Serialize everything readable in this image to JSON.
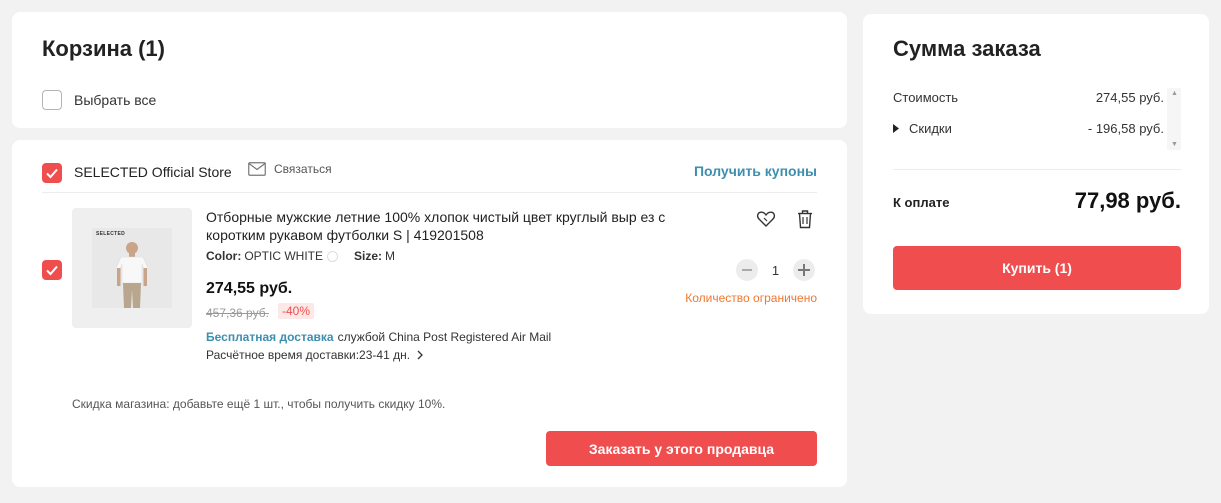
{
  "cart": {
    "title": "Корзина (1)",
    "select_all_label": "Выбрать все",
    "select_all_checked": false
  },
  "store": {
    "name": "SELECTED Official Store",
    "checked": true,
    "contact_label": "Связаться",
    "coupons_label": "Получить купоны",
    "item": {
      "checked": true,
      "thumbnail_brand": "SELECTED",
      "title": "Отборные мужские летние 100% хлопок чистый цвет круглый выр ез с коротким рукавом футболки S | 419201508",
      "color_key": "Color:",
      "color_value": "OPTIC WHITE",
      "size_key": "Size:",
      "size_value": "M",
      "price": "274,55 руб.",
      "old_price": "457,36 руб.",
      "discount": "-40%",
      "shipping_free": "Бесплатная доставка",
      "shipping_service": "службой China Post Registered Air Mail",
      "delivery_estimate": "Расчётное время доставки:23-41 дн.",
      "quantity": "1",
      "quantity_note": "Количество ограничено"
    },
    "store_discount_note": "Скидка магазина:  добавьте ещё 1 шт., чтобы получить скидку 10%.",
    "order_button": "Заказать у этого продавца"
  },
  "summary": {
    "title": "Сумма заказа",
    "cost_label": "Стоимость",
    "cost_value": "274,55 руб.",
    "discounts_label": "Скидки",
    "discounts_value": "- 196,58 руб.",
    "pay_label": "К оплате",
    "pay_total": "77,98 руб.",
    "buy_button": "Купить (1)"
  },
  "colors": {
    "accent_red": "#f04d4e",
    "link_blue": "#3d8fb0",
    "warning_orange": "#f0772e"
  }
}
